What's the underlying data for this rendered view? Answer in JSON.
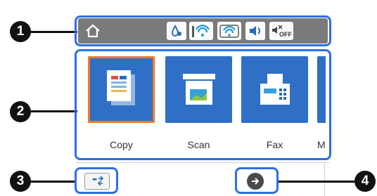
{
  "callouts": [
    "1",
    "2",
    "3",
    "4"
  ],
  "status_bar": {
    "home_icon": "home-icon",
    "icons": [
      "ink-drop-icon",
      "wifi-icon",
      "wifi-direct-icon",
      "sound-icon",
      "quiet-mode-off-icon"
    ],
    "quiet_label": "OFF"
  },
  "tiles": [
    {
      "name": "copy",
      "label": "Copy",
      "icon": "copy-icon",
      "selected": true
    },
    {
      "name": "scan",
      "label": "Scan",
      "icon": "scan-icon",
      "selected": false
    },
    {
      "name": "fax",
      "label": "Fax",
      "icon": "fax-icon",
      "selected": false
    },
    {
      "name": "more",
      "label": "M",
      "icon": "more-icon",
      "selected": false
    }
  ],
  "bottom": {
    "left_icon": "fax-send-receive-icon",
    "right_icon": "next-arrow-icon"
  },
  "colors": {
    "frame": "#2f6fe0",
    "tile": "#2f6fc6",
    "selected_border": "#f07a2a",
    "status_bar": "#7a7a7a"
  }
}
